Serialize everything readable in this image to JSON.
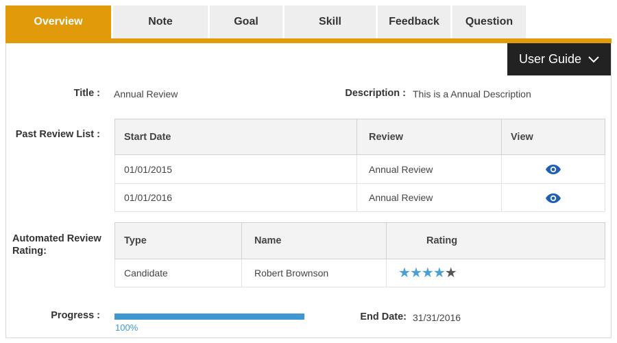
{
  "tabs": [
    {
      "label": "Overview",
      "active": true
    },
    {
      "label": "Note"
    },
    {
      "label": "Goal"
    },
    {
      "label": "Skill"
    },
    {
      "label": "Feedback"
    },
    {
      "label": "Question"
    }
  ],
  "colors": {
    "accent": "#e09a0a",
    "progress": "#3f97d0",
    "star": "#4a9fd4",
    "eye": "#1f5fb8"
  },
  "user_guide": {
    "label": "User Guide",
    "icon": "chevron-down-icon"
  },
  "details": {
    "title_label": "Title :",
    "title_value": "Annual Review",
    "description_label": "Description :",
    "description_value": "This is a Annual Description"
  },
  "past_reviews": {
    "label": "Past Review List :",
    "headers": [
      "Start Date",
      "Review",
      "View"
    ],
    "rows": [
      {
        "start_date": "01/01/2015",
        "review": "Annual Review",
        "view_icon": "eye-icon"
      },
      {
        "start_date": "01/01/2016",
        "review": "Annual Review",
        "view_icon": "eye-icon"
      }
    ]
  },
  "automated_rating": {
    "label_line1": "Automated Review",
    "label_line2": "Rating:",
    "headers": [
      "Type",
      "Name",
      "Rating"
    ],
    "rows": [
      {
        "type": "Candidate",
        "name": "Robert Brownson",
        "rating": 4,
        "max": 5
      }
    ]
  },
  "progress": {
    "label": "Progress :",
    "percent": 100,
    "text": "100%"
  },
  "end_date": {
    "label": "End Date:",
    "value": "31/31/2016"
  }
}
